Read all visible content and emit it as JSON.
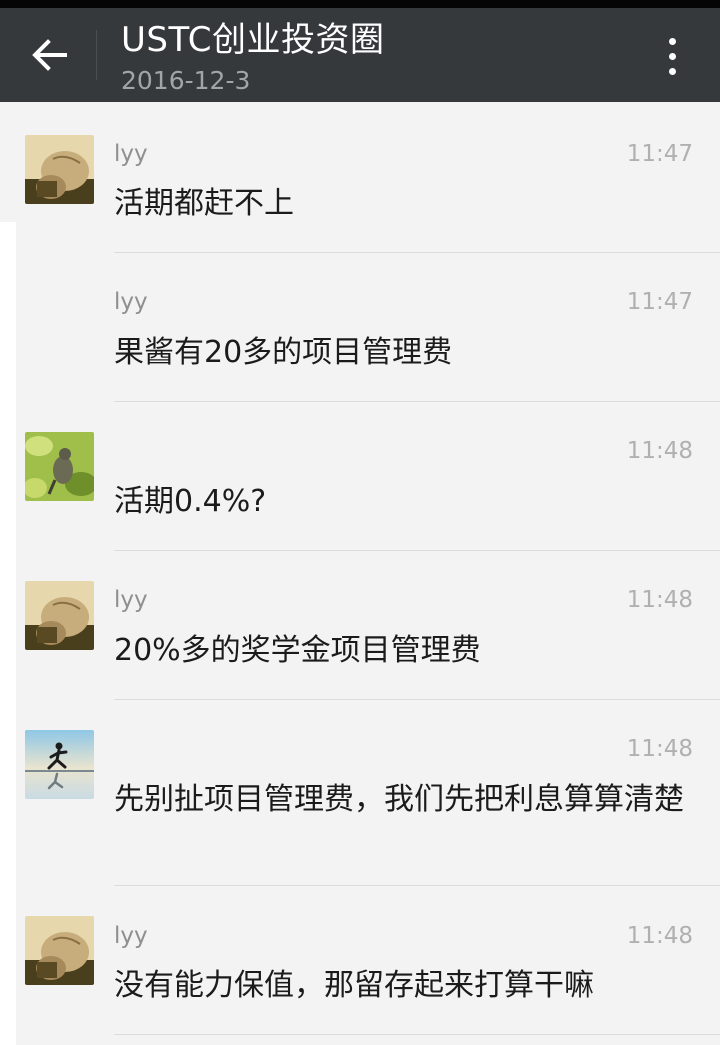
{
  "header": {
    "title": "USTC创业投资圈",
    "subtitle": "2016-12-3"
  },
  "messages": [
    {
      "sender": "lyy",
      "time": "11:47",
      "text": "活期都赶不上",
      "avatar": "fist-avatar"
    },
    {
      "sender": "lyy",
      "time": "11:47",
      "text": "果酱有20多的项目管理费",
      "avatar": ""
    },
    {
      "sender": "",
      "time": "11:48",
      "text": "活期0.4%?",
      "avatar": "bird-avatar"
    },
    {
      "sender": "lyy",
      "time": "11:48",
      "text": "20%多的奖学金项目管理费",
      "avatar": "fist-avatar"
    },
    {
      "sender": "",
      "time": "11:48",
      "text": "先别扯项目管理费，我们先把利息算算清楚",
      "avatar": "runner-avatar"
    },
    {
      "sender": "lyy",
      "time": "11:48",
      "text": "没有能力保值，那留存起来打算干嘛",
      "avatar": "fist-avatar"
    }
  ],
  "colors": {
    "appbar": "#35393c",
    "background": "#f3f3f3",
    "message_text": "#1b1b1b",
    "meta_text": "#8f8f8f"
  }
}
